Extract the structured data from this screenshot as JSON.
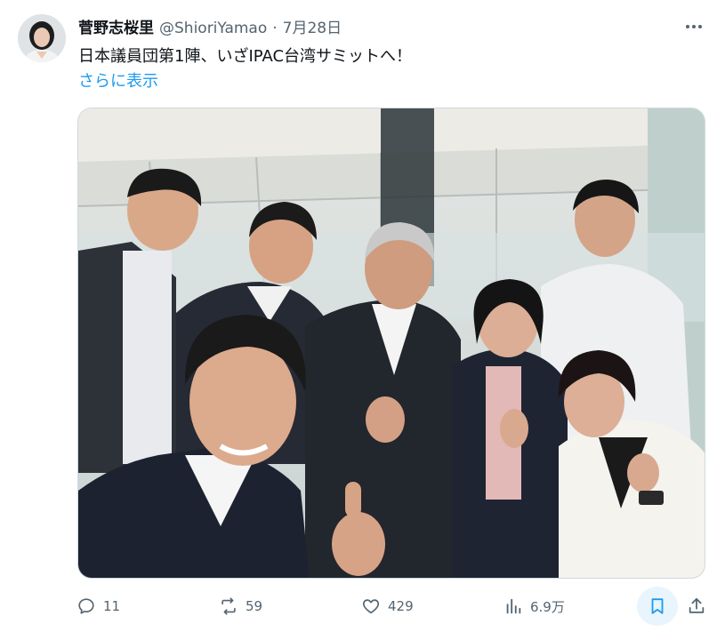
{
  "author": {
    "name": "菅野志桜里",
    "handle": "@ShioriYamao",
    "separator": "·",
    "date": "7月28日"
  },
  "tweet": {
    "text": "日本議員団第1陣、いざIPAC台湾サミットへ！",
    "show_more": "さらに表示"
  },
  "actions": {
    "reply": {
      "icon": "reply-icon",
      "count": "11"
    },
    "retweet": {
      "icon": "retweet-icon",
      "count": "59"
    },
    "like": {
      "icon": "heart-icon",
      "count": "429"
    },
    "views": {
      "icon": "views-icon",
      "count": "6.9万"
    },
    "bookmark": {
      "icon": "bookmark-icon"
    },
    "share": {
      "icon": "share-icon"
    }
  },
  "colors": {
    "accent": "#1d9bf0",
    "text": "#0f1419",
    "muted": "#536471"
  }
}
